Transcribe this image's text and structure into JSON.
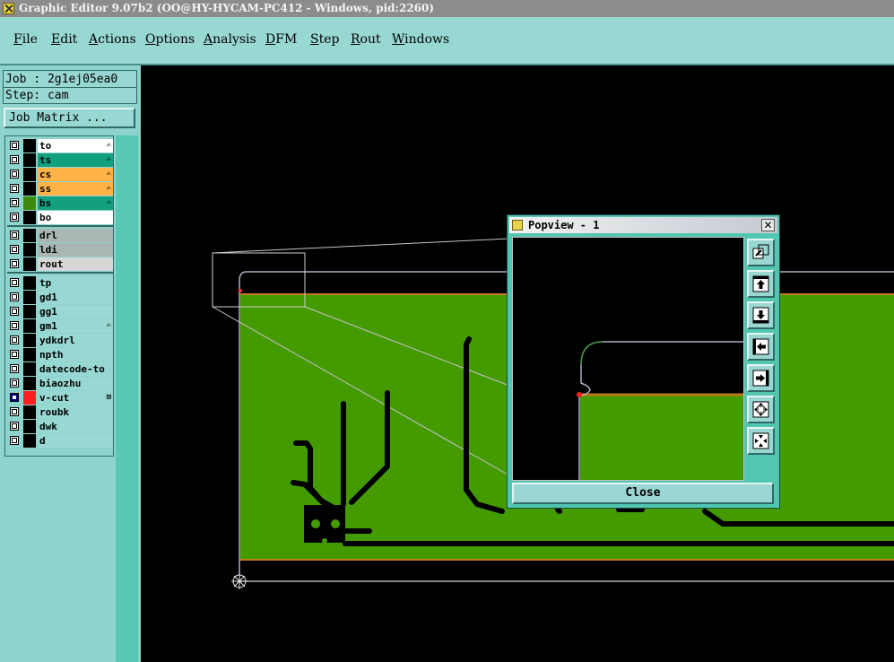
{
  "window": {
    "title": "Graphic Editor 9.07b2 (OO@HY-HYCAM-PC412 - Windows, pid:2260)"
  },
  "menu": [
    {
      "key": "F",
      "rest": "ile"
    },
    {
      "key": "E",
      "rest": "dit"
    },
    {
      "key": "A",
      "rest": "ctions"
    },
    {
      "key": "O",
      "rest": "ptions"
    },
    {
      "key": "A",
      "rest": "nalysis"
    },
    {
      "key": "D",
      "rest": "FM"
    },
    {
      "key": "S",
      "rest": "tep"
    },
    {
      "key": "R",
      "rest": "out"
    },
    {
      "key": "W",
      "rest": "indows"
    }
  ],
  "job": {
    "job_line": "Job : 2g1ej05ea0",
    "step_line": "Step: cam",
    "matrix_button": "Job Matrix ..."
  },
  "layers": [
    {
      "name": "to",
      "bg": "#ffffff",
      "affected": true,
      "checked": false,
      "swatch": "#000000"
    },
    {
      "name": "ts",
      "bg": "#13a07e",
      "affected": true,
      "checked": false,
      "swatch": "#000000"
    },
    {
      "name": "cs",
      "bg": "#ffb347",
      "affected": true,
      "checked": false,
      "swatch": "#000000"
    },
    {
      "name": "ss",
      "bg": "#ffb347",
      "affected": true,
      "checked": false,
      "swatch": "#000000"
    },
    {
      "name": "bs",
      "bg": "#13a07e",
      "affected": true,
      "checked": false,
      "swatch": "#3e8a0c"
    },
    {
      "name": "bo",
      "bg": "#ffffff",
      "affected": false,
      "checked": false,
      "swatch": "#000000"
    },
    {
      "name": "drl",
      "bg": "#a9b6b4",
      "affected": false,
      "checked": false,
      "swatch": "#000000"
    },
    {
      "name": "ldi",
      "bg": "#a9b6b4",
      "affected": false,
      "checked": false,
      "swatch": "#000000"
    },
    {
      "name": "rout",
      "bg": "#d6d6d6",
      "affected": false,
      "checked": false,
      "swatch": "#000000"
    },
    {
      "name": "tp",
      "bg": "#98d8d3",
      "affected": false,
      "checked": false,
      "swatch": "#000000"
    },
    {
      "name": "gd1",
      "bg": "#98d8d3",
      "affected": false,
      "checked": false,
      "swatch": "#000000"
    },
    {
      "name": "gg1",
      "bg": "#98d8d3",
      "affected": false,
      "checked": false,
      "swatch": "#000000"
    },
    {
      "name": "gm1",
      "bg": "#98d8d3",
      "affected": true,
      "checked": false,
      "swatch": "#000000"
    },
    {
      "name": "ydkdrl",
      "bg": "#98d8d3",
      "affected": false,
      "checked": false,
      "swatch": "#000000"
    },
    {
      "name": "npth",
      "bg": "#98d8d3",
      "affected": false,
      "checked": false,
      "swatch": "#000000"
    },
    {
      "name": "datecode-to",
      "bg": "#98d8d3",
      "affected": false,
      "checked": false,
      "swatch": "#000000"
    },
    {
      "name": "biaozhu",
      "bg": "#98d8d3",
      "affected": false,
      "checked": false,
      "swatch": "#000000"
    },
    {
      "name": "v-cut",
      "bg": "#98d8d3",
      "affected": true,
      "checked": true,
      "swatch": "#ff1f1f"
    },
    {
      "name": "roubk",
      "bg": "#98d8d3",
      "affected": false,
      "checked": false,
      "swatch": "#000000"
    },
    {
      "name": "dwk",
      "bg": "#98d8d3",
      "affected": false,
      "checked": false,
      "swatch": "#000000"
    },
    {
      "name": "d",
      "bg": "#98d8d3",
      "affected": false,
      "checked": false,
      "swatch": "#000000"
    }
  ],
  "popview": {
    "title": "Popview - 1",
    "close_label": "Close",
    "close_x": "✕"
  },
  "colors": {
    "board_green": "#449b00",
    "menu_teal": "#98d8d3",
    "panel_teal": "#53c6b2",
    "trace": "#000000"
  }
}
